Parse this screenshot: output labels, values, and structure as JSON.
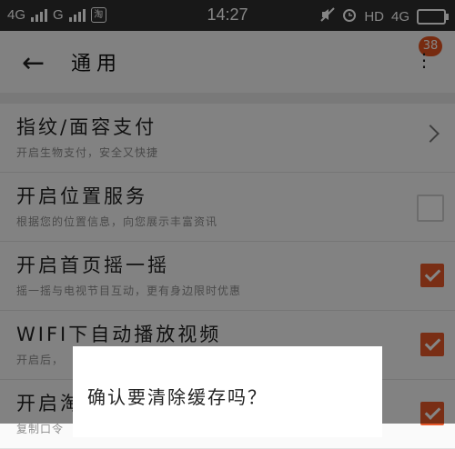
{
  "status_bar": {
    "net1": "4G",
    "net2": "G",
    "app_icon_char": "淘",
    "time": "14:27",
    "hd_label": "HD",
    "net3": "4G"
  },
  "header": {
    "title": "通用",
    "badge": "38"
  },
  "settings": [
    {
      "title": "指纹/面容支付",
      "subtitle": "开启生物支付，安全又快捷",
      "control": "chevron"
    },
    {
      "title": "开启位置服务",
      "subtitle": "根据您的位置信息，向您展示丰富资讯",
      "control": "checkbox",
      "checked": false
    },
    {
      "title": "开启首页摇一摇",
      "subtitle": "摇一摇与电视节目互动，更有身边限时优惠",
      "control": "checkbox",
      "checked": true
    },
    {
      "title": "WIFI下自动播放视频",
      "subtitle": "开启后，",
      "control": "checkbox",
      "checked": true
    },
    {
      "title": "开启淘",
      "subtitle": "复制口令",
      "control": "checkbox",
      "checked": true
    }
  ],
  "dialog": {
    "message": "确认要清除缓存吗？"
  },
  "colors": {
    "accent": "#e8582a",
    "status_bar": "#2f2f2f"
  }
}
